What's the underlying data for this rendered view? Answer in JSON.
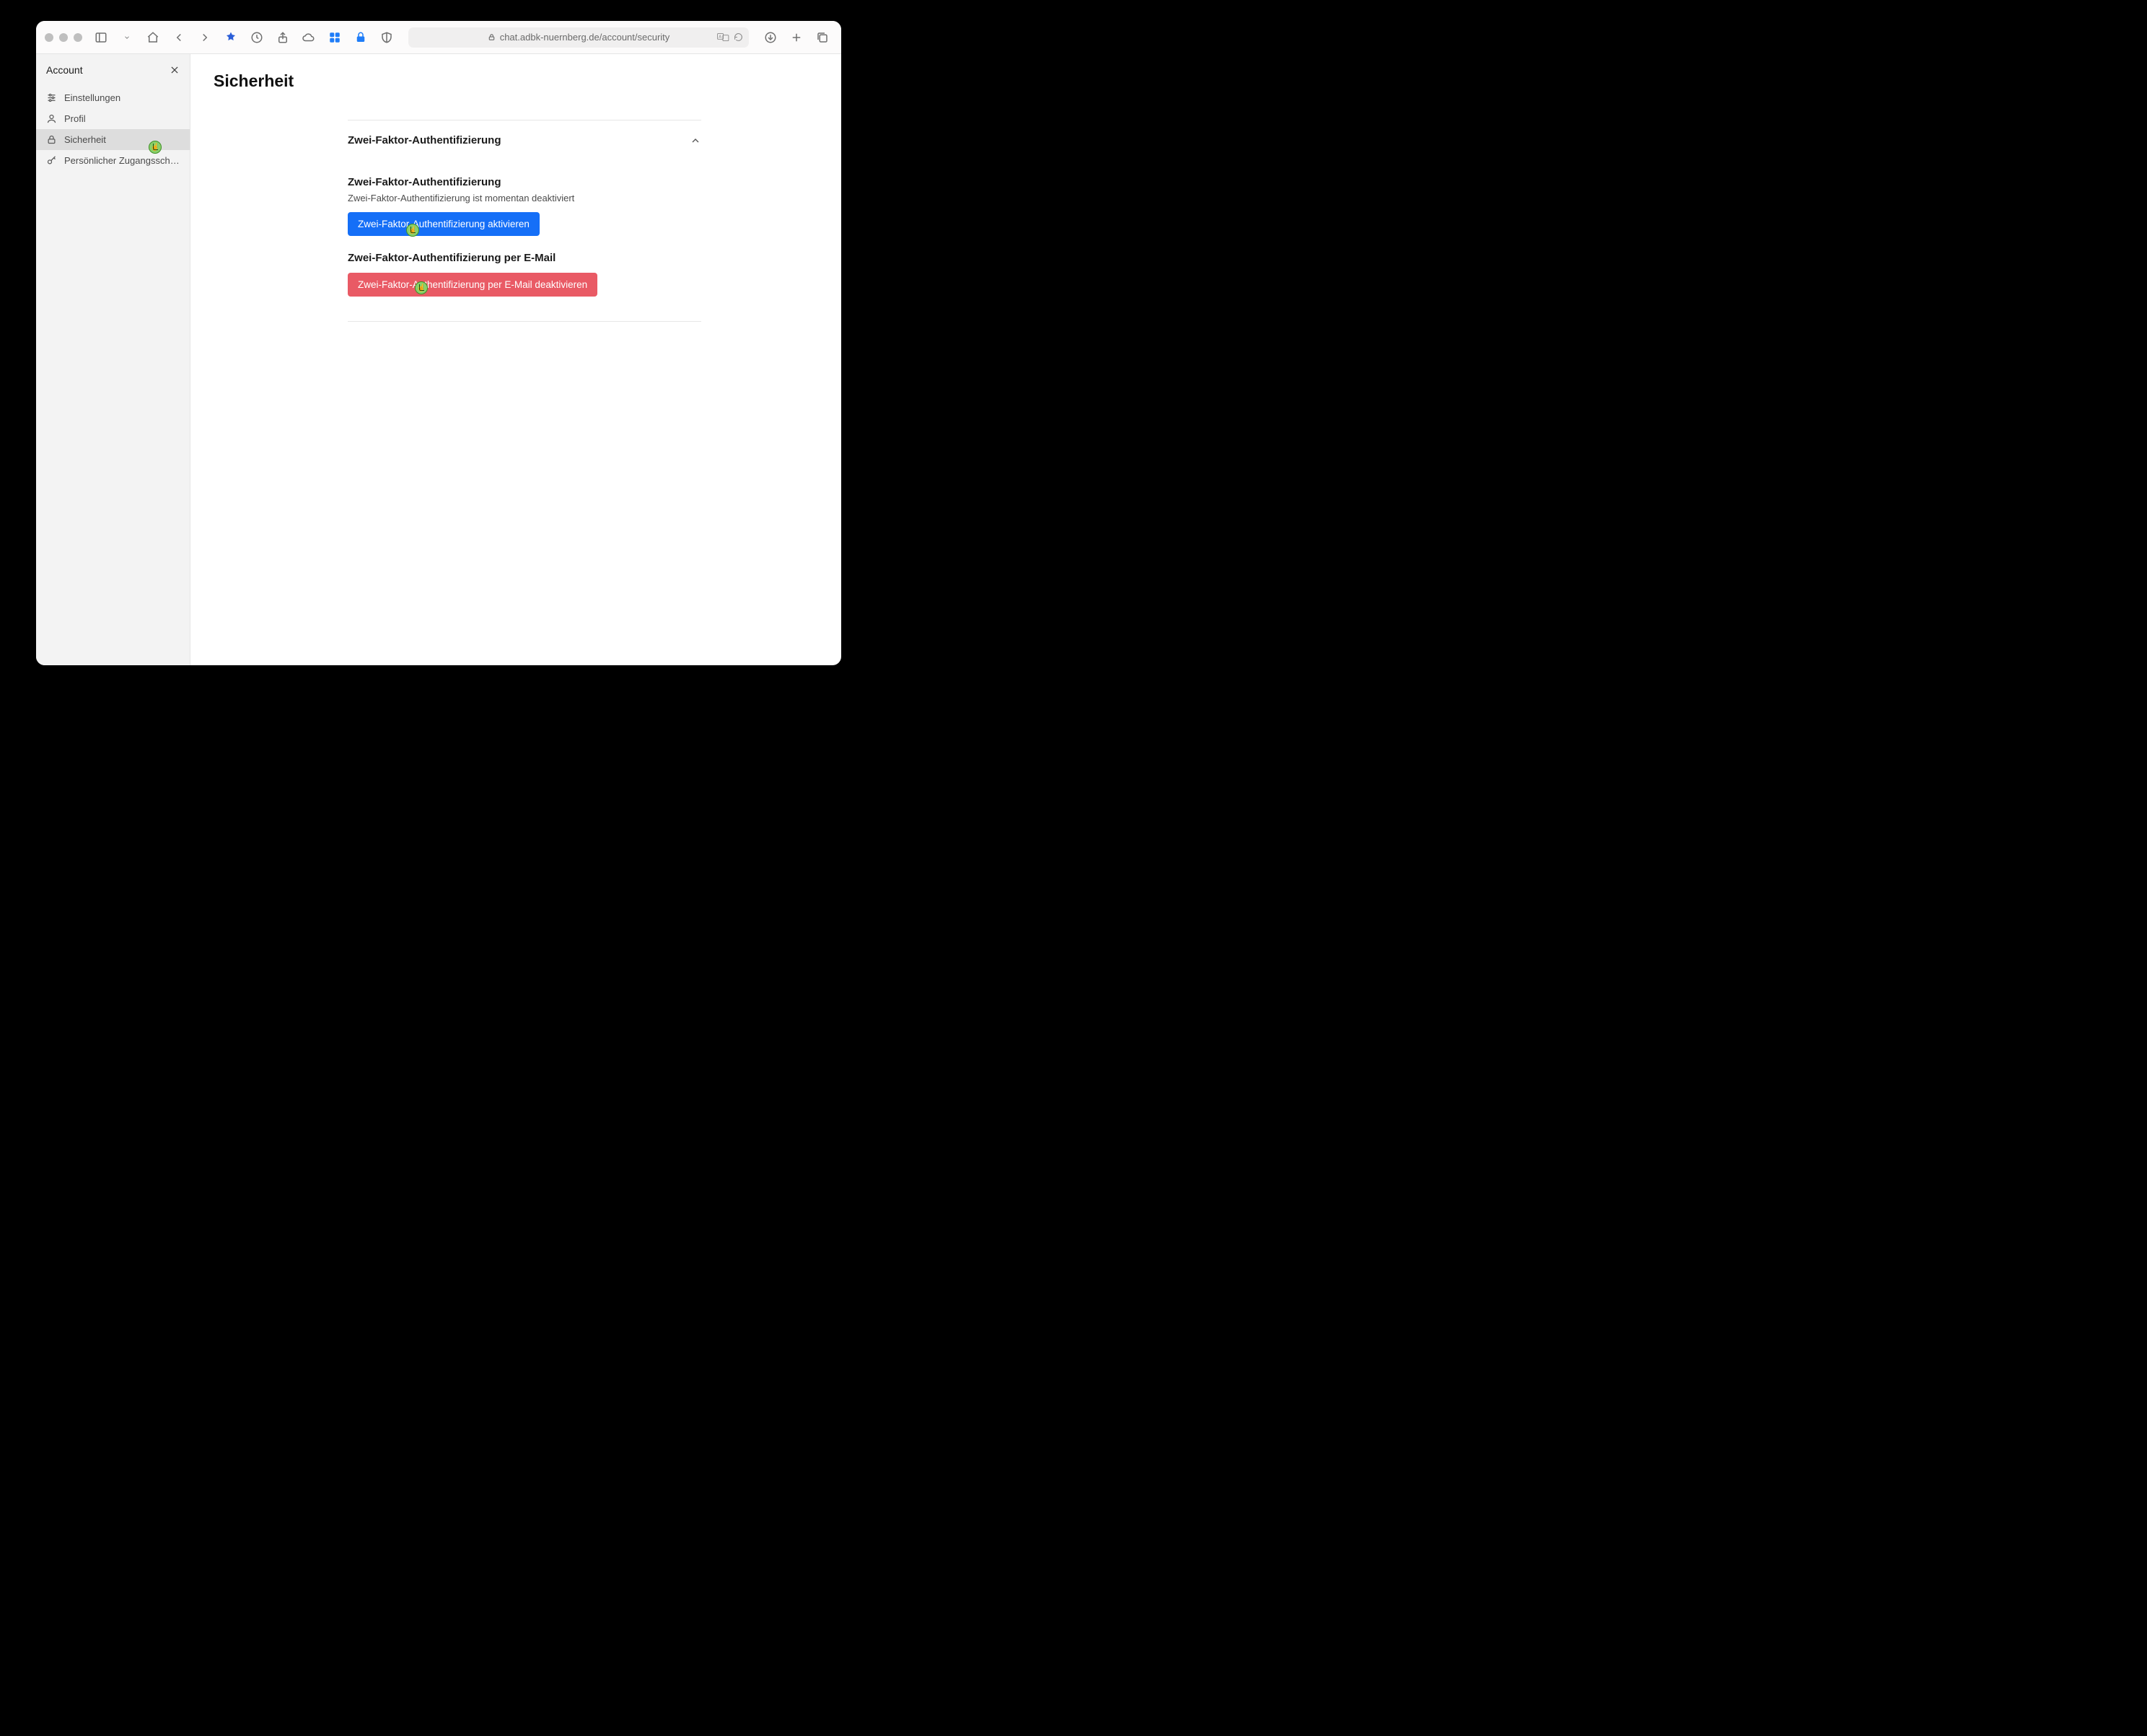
{
  "browser": {
    "url": "chat.adbk-nuernberg.de/account/security"
  },
  "sidebar": {
    "title": "Account",
    "items": [
      {
        "label": "Einstellungen"
      },
      {
        "label": "Profil"
      },
      {
        "label": "Sicherheit"
      },
      {
        "label": "Persönlicher Zugangsschlüs…"
      }
    ],
    "active_index": 2
  },
  "page": {
    "title": "Sicherheit",
    "section": {
      "title": "Zwei-Faktor-Authentifizierung",
      "tfa": {
        "heading": "Zwei-Faktor-Authentifizierung",
        "status": "Zwei-Faktor-Authentifizierung ist momentan deaktiviert",
        "enable_label": "Zwei-Faktor-Authentifizierung aktivieren"
      },
      "tfa_email": {
        "heading": "Zwei-Faktor-Authentifizierung per E-Mail",
        "disable_label": "Zwei-Faktor-Authentifizierung per E-Mail deaktivieren"
      }
    }
  },
  "colors": {
    "primary": "#156ff7",
    "danger": "#e95a65"
  }
}
